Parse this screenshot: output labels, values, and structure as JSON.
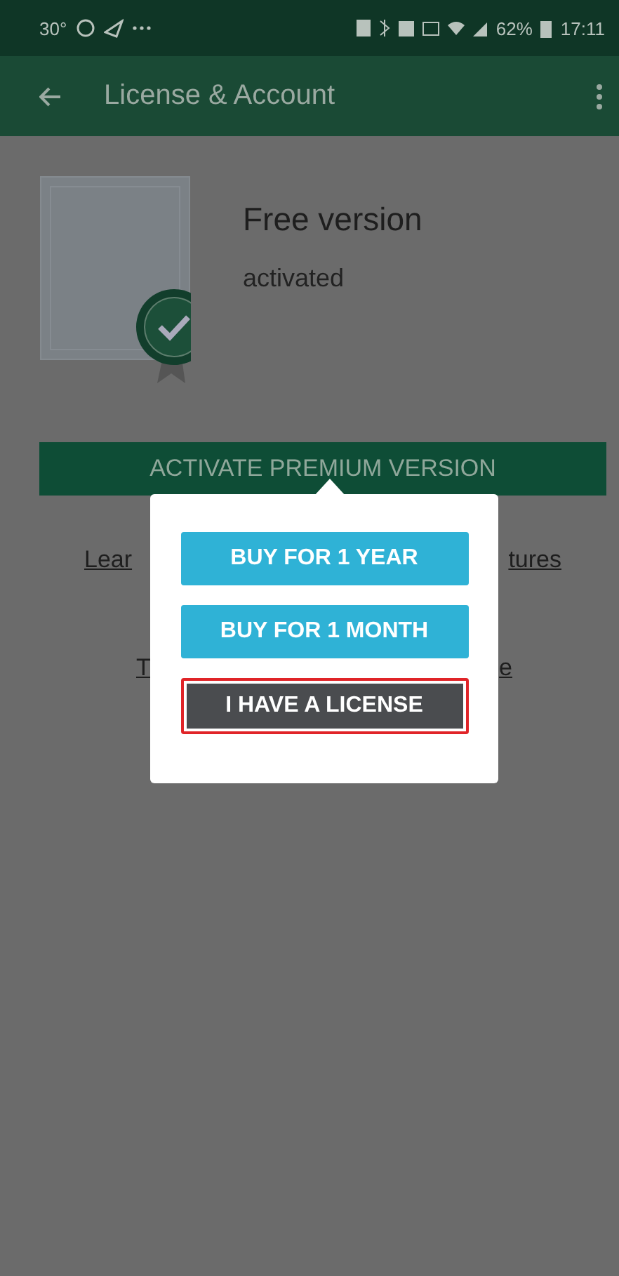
{
  "status_bar": {
    "temperature": "30°",
    "battery": "62%",
    "time": "17:11"
  },
  "toolbar": {
    "title": "License & Account"
  },
  "license": {
    "title": "Free version",
    "status": "activated"
  },
  "activate_button": "ACTIVATE PREMIUM VERSION",
  "links": [
    {
      "left": "Lear",
      "right": "tures"
    },
    {
      "left": "T",
      "right": "e"
    }
  ],
  "popup": {
    "buttons": [
      {
        "label": "BUY FOR 1 YEAR",
        "kind": "buy",
        "focused": false
      },
      {
        "label": "BUY FOR 1 MONTH",
        "kind": "buy",
        "focused": false
      },
      {
        "label": "I HAVE A LICENSE",
        "kind": "license",
        "focused": true
      }
    ]
  }
}
